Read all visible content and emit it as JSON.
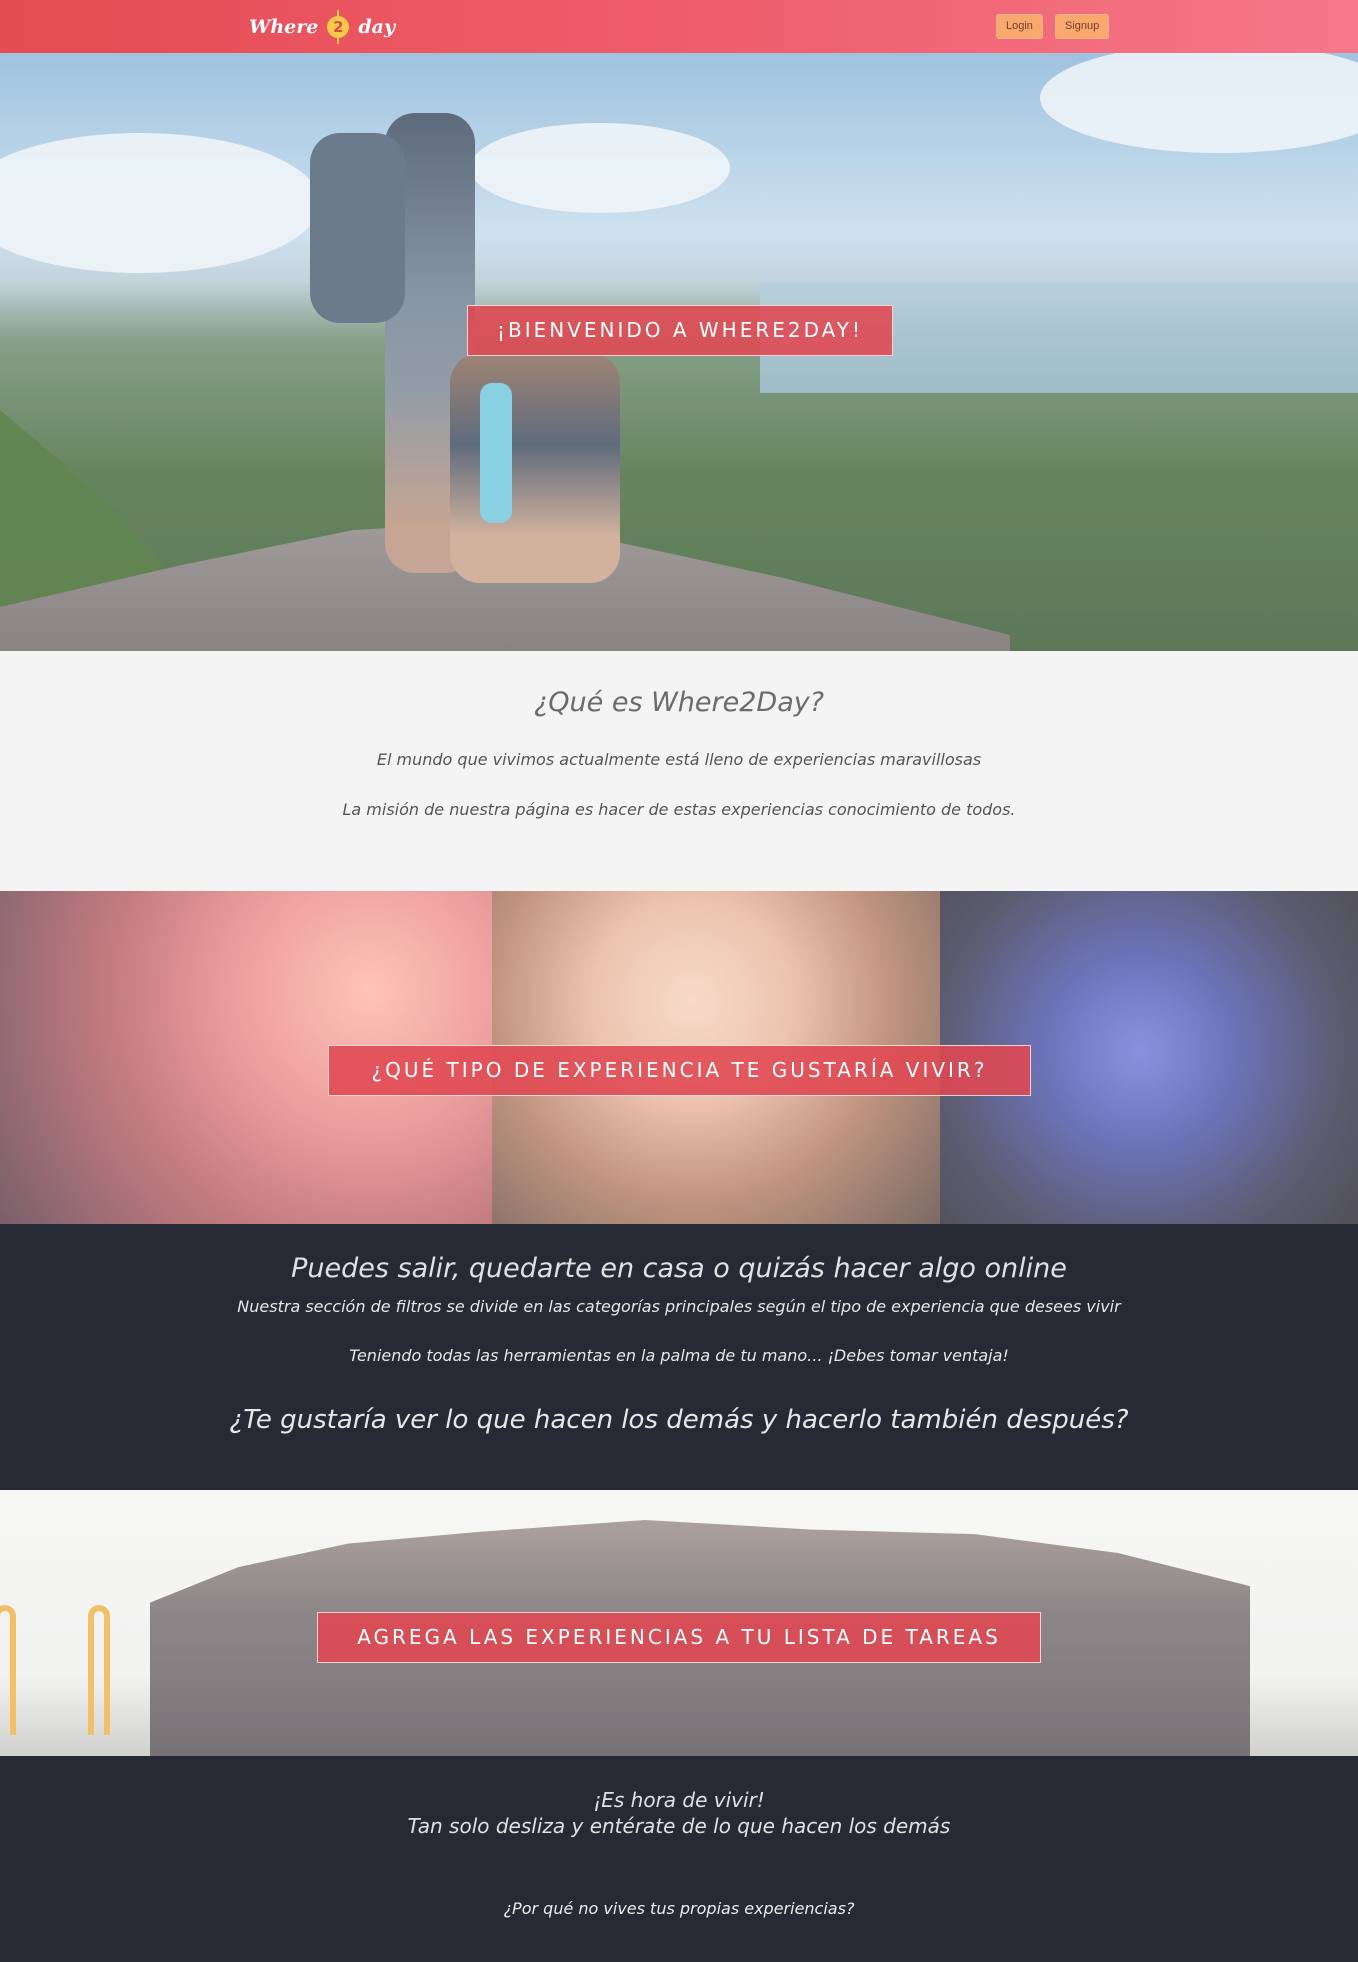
{
  "navbar": {
    "logo_left": "Where",
    "logo_number": "2",
    "logo_right": "day",
    "login_label": "Login",
    "signup_label": "Signup"
  },
  "hero": {
    "banner": "¡BIENVENIDO A WHERE2DAY!"
  },
  "about": {
    "title": "¿Qué es Where2Day?",
    "line1": "El mundo que vivimos actualmente está lleno de experiencias maravillosas",
    "line2": "La misión de nuestra página es hacer de estas experiencias conocimiento de todos."
  },
  "experiences": {
    "banner": "¿QUÉ TIPO DE EXPERIENCIA TE GUSTARÍA VIVIR?"
  },
  "filters": {
    "headline": "Puedes salir, quedarte en casa o quizás hacer algo online",
    "description": "Nuestra sección de filtros se divide en las categorías principales según el tipo de experiencia que desees vivir",
    "tools": "Teniendo todas las herramientas en la palma de tu mano... ¡Debes tomar ventaja!",
    "question": "¿Te gustaría ver lo que hacen los demás y hacerlo también después?"
  },
  "group": {
    "banner": "AGREGA LAS EXPERIENCIAS A TU LISTA DE TAREAS"
  },
  "closing": {
    "line1": "¡Es hora de vivir!",
    "line2": "Tan solo desliza y entérate de lo que hacen los demás",
    "line3": "¿Por qué no vives tus propias experiencias?"
  },
  "colors": {
    "navbar_start": "#e54b52",
    "navbar_end": "#f67889",
    "banner": "#e04852",
    "nav_button": "#f9a86e",
    "dark_section": "#262a34",
    "light_section": "#f4f4f4"
  }
}
